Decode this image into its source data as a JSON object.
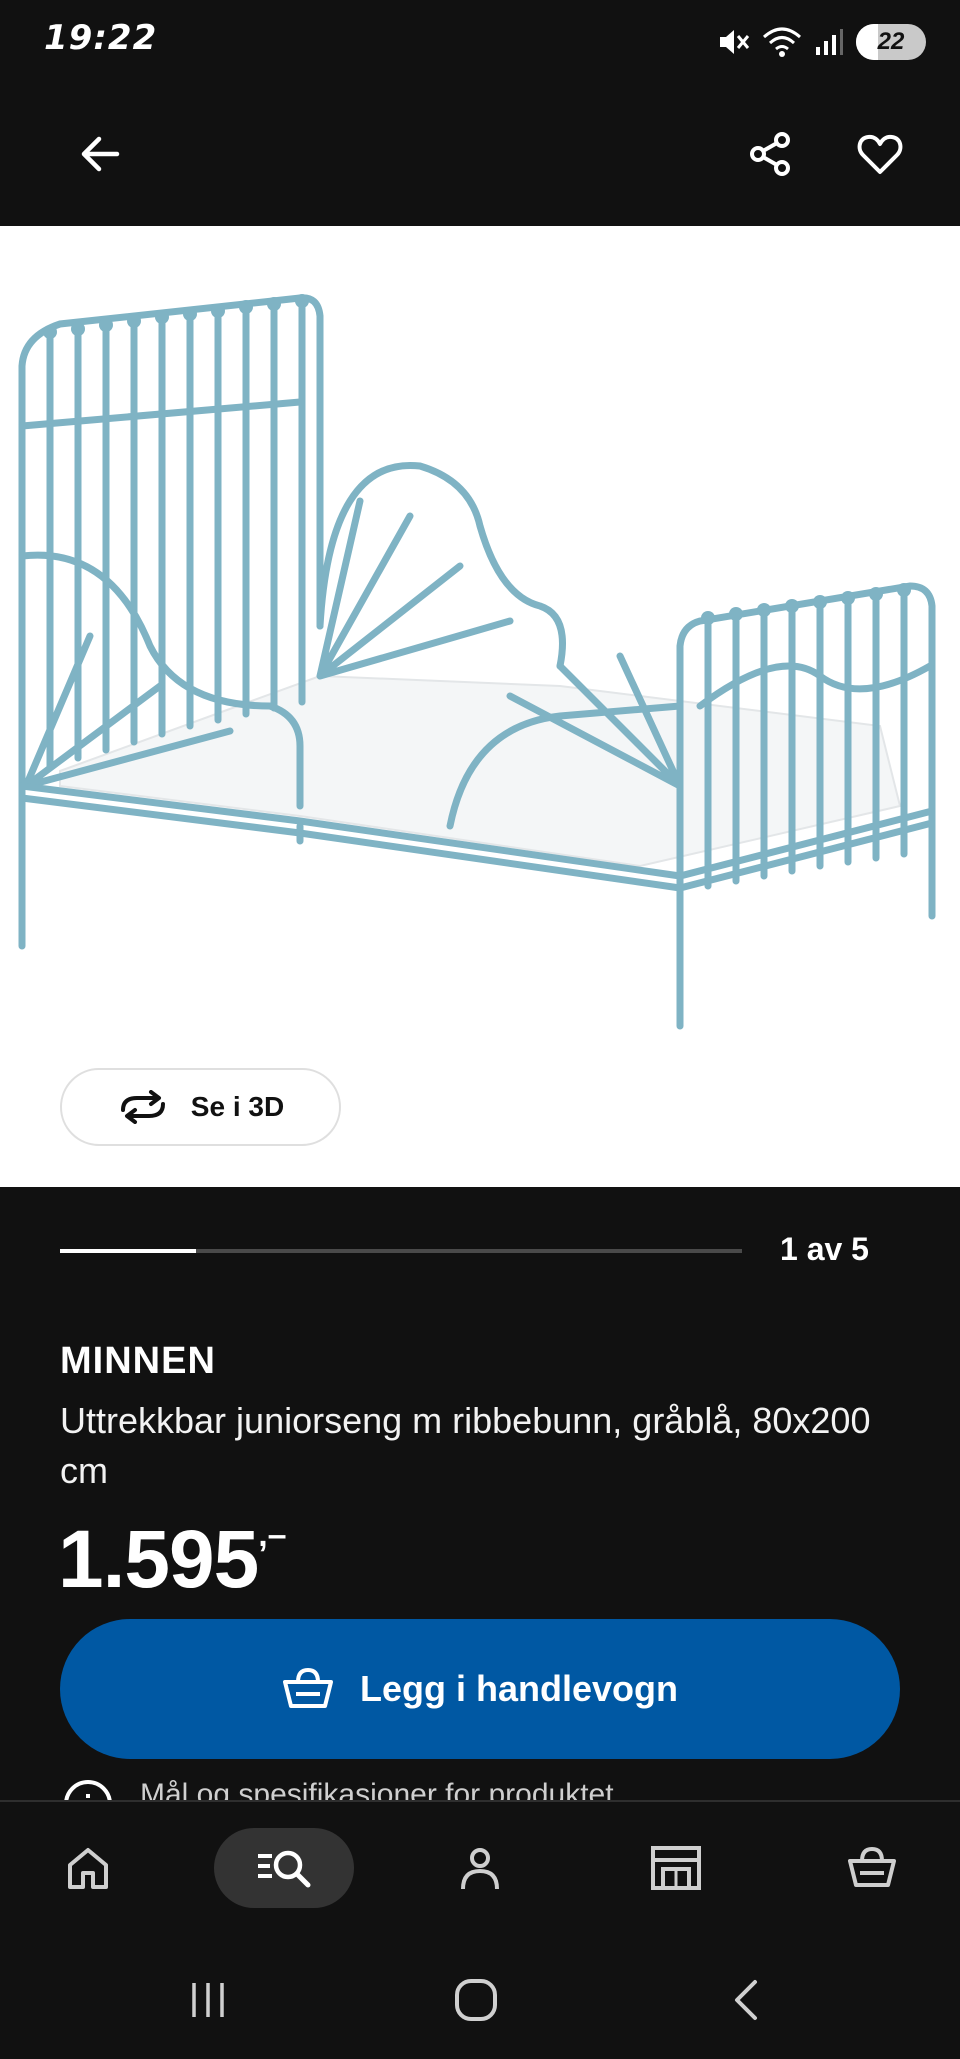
{
  "status_bar": {
    "time": "19:22",
    "battery_level": "22"
  },
  "header": {
    "back_icon": "arrow-left-icon",
    "share_icon": "share-icon",
    "favorite_icon": "heart-icon"
  },
  "gallery": {
    "view_3d_label": "Se i 3D",
    "position_label": "1 av 5",
    "current_index": 1,
    "total": 5
  },
  "product": {
    "name": "MINNEN",
    "description": "Uttrekkbar juniorseng m ribbebunn, gråblå, 80x200 cm",
    "price": "1.595",
    "price_suffix": ",–"
  },
  "cart": {
    "add_label": "Legg i handlevogn"
  },
  "peek": {
    "text": "Mål og spesifikasjoner for produktet"
  },
  "bottom_nav": [
    {
      "name": "home",
      "icon": "home-icon"
    },
    {
      "name": "search",
      "icon": "search-icon",
      "active": true
    },
    {
      "name": "profile",
      "icon": "user-icon"
    },
    {
      "name": "store",
      "icon": "store-icon"
    },
    {
      "name": "cart",
      "icon": "basket-icon"
    }
  ],
  "colors": {
    "background": "#111111",
    "accent": "#0058a3",
    "bed": "#7fb3c4"
  }
}
